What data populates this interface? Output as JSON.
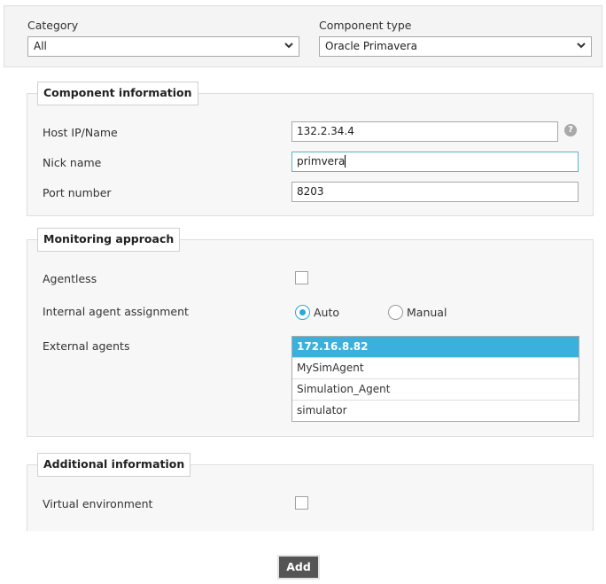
{
  "category": {
    "label": "Category",
    "value": "All"
  },
  "component_type": {
    "label": "Component type",
    "value": "Oracle Primavera"
  },
  "component_info": {
    "title": "Component information",
    "host": {
      "label": "Host IP/Name",
      "value": "132.2.34.4"
    },
    "help_icon": "?",
    "nick": {
      "label": "Nick name",
      "value": "primvera"
    },
    "port": {
      "label": "Port number",
      "value": "8203"
    }
  },
  "monitoring": {
    "title": "Monitoring approach",
    "agentless": {
      "label": "Agentless",
      "checked": false
    },
    "internal": {
      "label": "Internal agent assignment",
      "options": [
        "Auto",
        "Manual"
      ],
      "selected": "Auto"
    },
    "external": {
      "label": "External agents",
      "items": [
        "172.16.8.82",
        "MySimAgent",
        "Simulation_Agent",
        "simulator"
      ],
      "selected": "172.16.8.82"
    }
  },
  "additional": {
    "title": "Additional information",
    "virtual": {
      "label": "Virtual environment",
      "checked": false
    }
  },
  "add_button": "Add",
  "colors": {
    "accent": "#3ab0dd",
    "button": "#555555"
  }
}
